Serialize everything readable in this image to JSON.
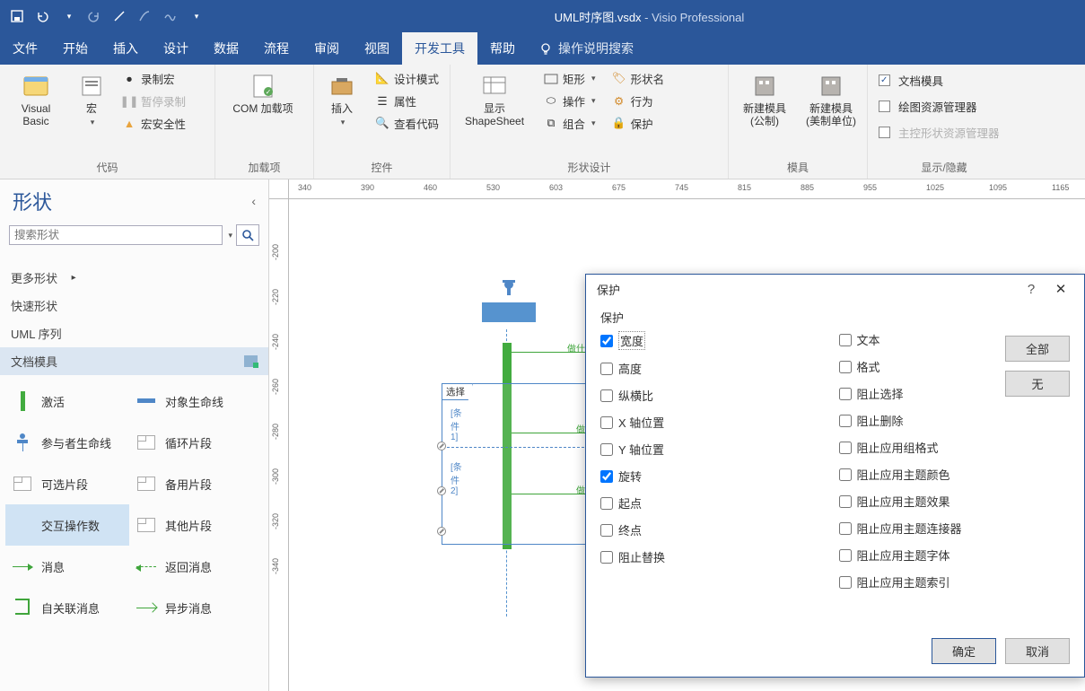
{
  "title": {
    "filename": "UML时序图.vsdx",
    "app": "Visio Professional",
    "sep": " - "
  },
  "tabs": [
    "文件",
    "开始",
    "插入",
    "设计",
    "数据",
    "流程",
    "审阅",
    "视图",
    "开发工具",
    "帮助"
  ],
  "tabs_active": 8,
  "tell_me": "操作说明搜索",
  "ribbon": {
    "code": {
      "label": "代码",
      "visual_basic": "Visual Basic",
      "macros": "宏",
      "record": "录制宏",
      "pause": "暂停录制",
      "security": "宏安全性"
    },
    "addins": {
      "label": "加载项",
      "com": "COM 加载项"
    },
    "controls": {
      "label": "控件",
      "insert": "插入",
      "design": "设计模式",
      "props": "属性",
      "viewcode": "查看代码"
    },
    "shape_design": {
      "label": "形状设计",
      "show": "显示\nShapeSheet",
      "rect": "矩形",
      "operations": "操作",
      "combine": "组合",
      "shapename": "形状名",
      "behavior": "行为",
      "protection": "保护"
    },
    "stencil": {
      "label": "模具",
      "new_cn": "新建模具\n(公制)",
      "new_us": "新建模具\n(美制单位)"
    },
    "showhide": {
      "label": "显示/隐藏",
      "doc_stencil": "文档模具",
      "drawing_explorer": "绘图资源管理器",
      "master_explorer": "主控形状资源管理器"
    }
  },
  "shapes_panel": {
    "title": "形状",
    "search_placeholder": "搜索形状",
    "more": "更多形状",
    "quick": "快速形状",
    "uml_seq": "UML 序列",
    "doc_stencil": "文档模具",
    "items": [
      "激活",
      "对象生命线",
      "参与者生命线",
      "循环片段",
      "可选片段",
      "备用片段",
      "交互操作数",
      "其他片段",
      "消息",
      "返回消息",
      "自关联消息",
      "异步消息"
    ],
    "selected": 6
  },
  "ruler_h": [
    "340",
    "390",
    "460",
    "530",
    "603",
    "675",
    "745",
    "815",
    "885",
    "955",
    "1025",
    "1095",
    "1165"
  ],
  "ruler_v": [
    "-200",
    "-220",
    "-240",
    "-260",
    "-280",
    "-300",
    "-320",
    "-340"
  ],
  "canvas": {
    "frame_label": "选择",
    "guard1": "[条件1]",
    "guard2": "[条件2]",
    "msg1": "做什么事",
    "msg2": "做事情",
    "msg3": "做事情"
  },
  "dialog": {
    "title": "保护",
    "group": "保护",
    "help": "?",
    "close": "✕",
    "all": "全部",
    "none": "无",
    "ok": "确定",
    "cancel": "取消",
    "col1": [
      {
        "label": "宽度",
        "checked": true,
        "hl": true
      },
      {
        "label": "高度",
        "checked": false
      },
      {
        "label": "纵横比",
        "checked": false
      },
      {
        "label": "X 轴位置",
        "checked": false
      },
      {
        "label": "Y 轴位置",
        "checked": false
      },
      {
        "label": "旋转",
        "checked": true
      },
      {
        "label": "起点",
        "checked": false
      },
      {
        "label": "终点",
        "checked": false
      },
      {
        "label": "阻止替换",
        "checked": false
      }
    ],
    "col2": [
      {
        "label": "文本",
        "checked": false
      },
      {
        "label": "格式",
        "checked": false
      },
      {
        "label": "阻止选择",
        "checked": false
      },
      {
        "label": "阻止删除",
        "checked": false
      },
      {
        "label": "阻止应用组格式",
        "checked": false
      },
      {
        "label": "阻止应用主题颜色",
        "checked": false
      },
      {
        "label": "阻止应用主题效果",
        "checked": false
      },
      {
        "label": "阻止应用主题连接器",
        "checked": false
      },
      {
        "label": "阻止应用主题字体",
        "checked": false
      },
      {
        "label": "阻止应用主题索引",
        "checked": false
      }
    ]
  }
}
